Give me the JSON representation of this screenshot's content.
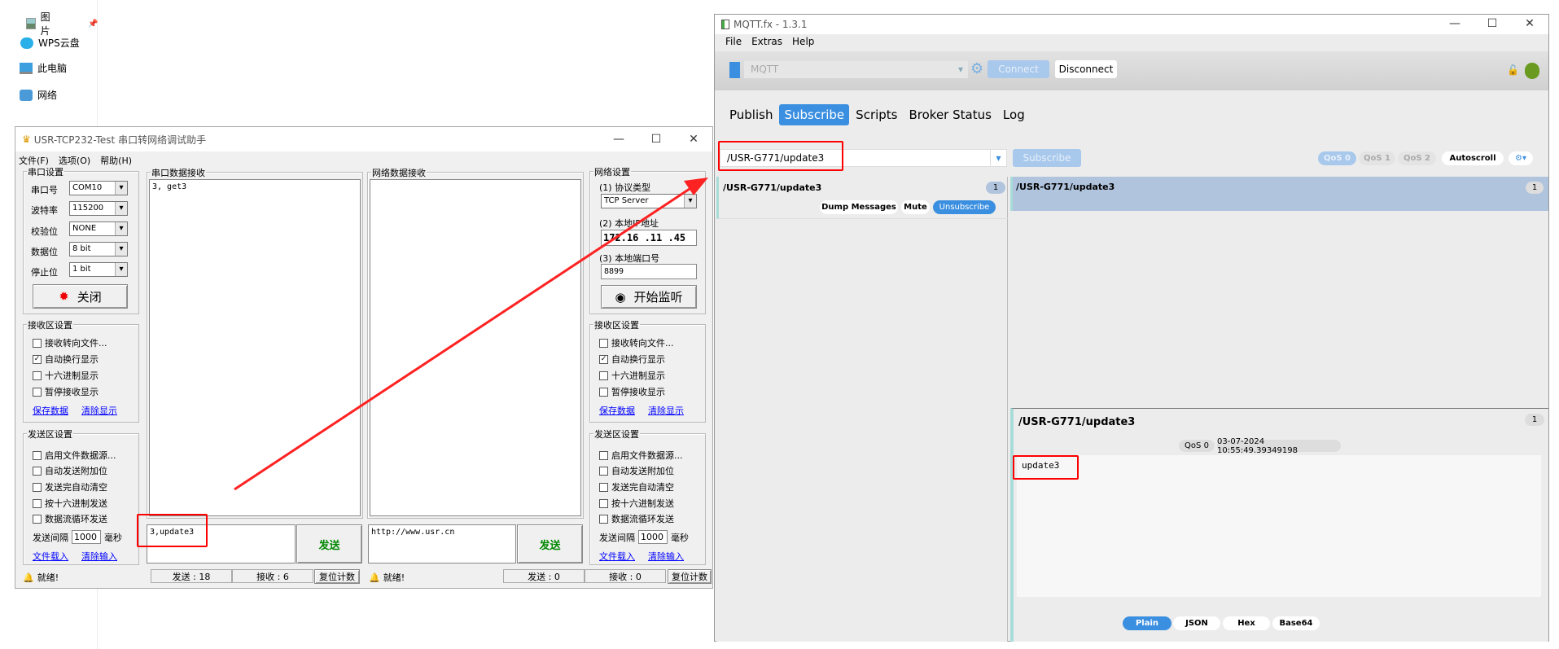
{
  "desktop_nav": {
    "items": [
      {
        "label": "图片",
        "icon": "picture-icon"
      },
      {
        "label": "WPS云盘",
        "icon": "cloud-icon"
      },
      {
        "label": "此电脑",
        "icon": "computer-icon"
      },
      {
        "label": "网络",
        "icon": "network-icon"
      }
    ]
  },
  "usr": {
    "title": "USR-TCP232-Test 串口转网络调试助手",
    "menu": [
      "文件(F)",
      "选项(O)",
      "帮助(H)"
    ],
    "serial_settings": {
      "title": "串口设置",
      "fields": [
        {
          "label": "串口号",
          "value": "COM10"
        },
        {
          "label": "波特率",
          "value": "115200"
        },
        {
          "label": "校验位",
          "value": "NONE"
        },
        {
          "label": "数据位",
          "value": "8 bit"
        },
        {
          "label": "停止位",
          "value": "1 bit"
        }
      ],
      "close_button": "关闭"
    },
    "serial_recv": {
      "title": "串口数据接收",
      "content": "3, get3"
    },
    "net_recv": {
      "title": "网络数据接收",
      "content": ""
    },
    "net_settings": {
      "title": "网络设置",
      "protocol_label": "(1) 协议类型",
      "protocol": "TCP Server",
      "ip_label": "(2) 本地IP地址",
      "ip": "172.16 .11 .45",
      "port_label": "(3) 本地端口号",
      "port": "8899",
      "listen_button": "开始监听"
    },
    "recv_settings": {
      "title": "接收区设置",
      "options": [
        {
          "label": "接收转向文件...",
          "checked": false
        },
        {
          "label": "自动换行显示",
          "checked": true
        },
        {
          "label": "十六进制显示",
          "checked": false
        },
        {
          "label": "暂停接收显示",
          "checked": false
        }
      ],
      "save_link": "保存数据",
      "clear_link": "清除显示"
    },
    "send_settings": {
      "title": "发送区设置",
      "options": [
        {
          "label": "启用文件数据源...",
          "checked": false
        },
        {
          "label": "自动发送附加位",
          "checked": false
        },
        {
          "label": "发送完自动清空",
          "checked": false
        },
        {
          "label": "按十六进制发送",
          "checked": false
        },
        {
          "label": "数据流循环发送",
          "checked": false
        }
      ],
      "interval_label": "发送间隔",
      "interval": "1000",
      "interval_unit": "毫秒",
      "load_link": "文件载入",
      "clear_link": "清除输入"
    },
    "serial_send": {
      "value": "3,update3",
      "button": "发送"
    },
    "net_send": {
      "value": "http://www.usr.cn",
      "button": "发送"
    },
    "status_left": {
      "ready": "就绪!",
      "sent": "发送 : 18",
      "recv": "接收 : 6",
      "reset": "复位计数"
    },
    "status_right": {
      "ready": "就绪!",
      "sent": "发送 : 0",
      "recv": "接收 : 0",
      "reset": "复位计数"
    }
  },
  "mqtt": {
    "title": "MQTT.fx - 1.3.1",
    "menu": [
      "File",
      "Extras",
      "Help"
    ],
    "profile": "MQTT",
    "connect": "Connect",
    "disconnect": "Disconnect",
    "status_color": "#6a9a1f",
    "tabs": [
      "Publish",
      "Subscribe",
      "Scripts",
      "Broker Status",
      "Log"
    ],
    "active_tab": "Subscribe",
    "topic_input": "/USR-G771/update3",
    "subscribe_button": "Subscribe",
    "qos": [
      "QoS 0",
      "QoS 1",
      "QoS 2"
    ],
    "autoscroll": "Autoscroll",
    "subscriptions": [
      {
        "topic": "/USR-G771/update3",
        "count": "1",
        "buttons": [
          "Dump Messages",
          "Mute",
          "Unsubscribe"
        ]
      }
    ],
    "messages": [
      {
        "topic": "/USR-G771/update3",
        "count": "1"
      }
    ],
    "detail": {
      "topic": "/USR-G771/update3",
      "count": "1",
      "qos": "QoS 0",
      "timestamp": "03-07-2024  10:55:49.39349198",
      "payload": "update3"
    },
    "formats": [
      "Plain",
      "JSON",
      "Hex",
      "Base64"
    ],
    "active_format": "Plain",
    "accent": "#3b8fe0"
  }
}
